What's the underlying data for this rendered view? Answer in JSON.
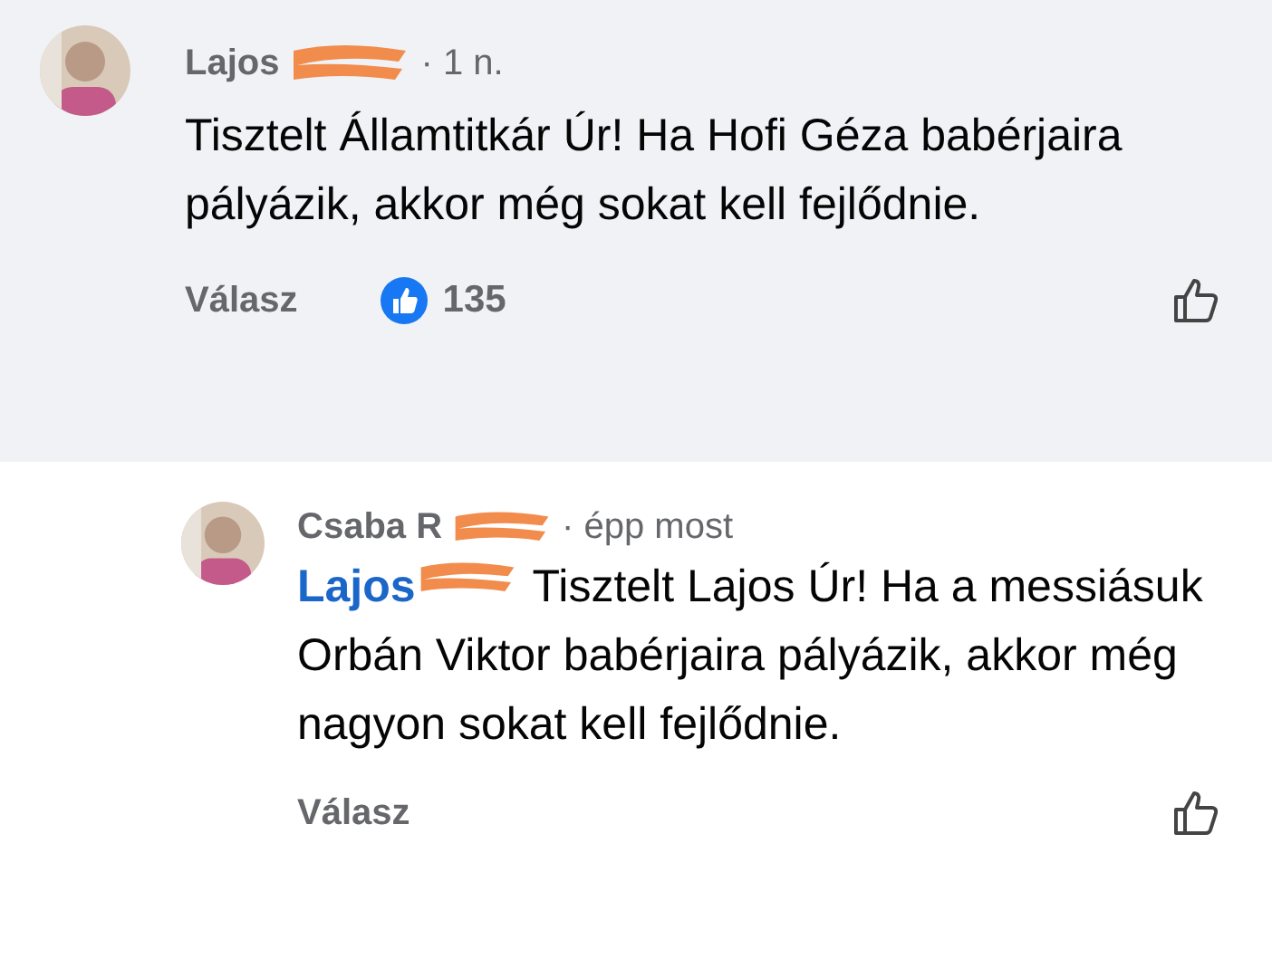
{
  "comments": [
    {
      "kind": "top",
      "author": "Lajos",
      "redacted": true,
      "time": "· 1 n.",
      "text": "Tisztelt Államtitkár Úr! Ha Hofi Géza babérjaira pályázik, akkor még sokat kell fejlődnie.",
      "reply_label": "Válasz",
      "likes": "135"
    },
    {
      "kind": "reply",
      "author": "Csaba R",
      "redacted": true,
      "time": "· épp most",
      "mention": "Lajos",
      "mention_redacted": true,
      "text": "Tisztelt Lajos Úr! Ha a messiásuk Orbán Viktor babérjaira pályázik, akkor még nagyon sokat kell fejlődnie.",
      "reply_label": "Válasz"
    }
  ]
}
